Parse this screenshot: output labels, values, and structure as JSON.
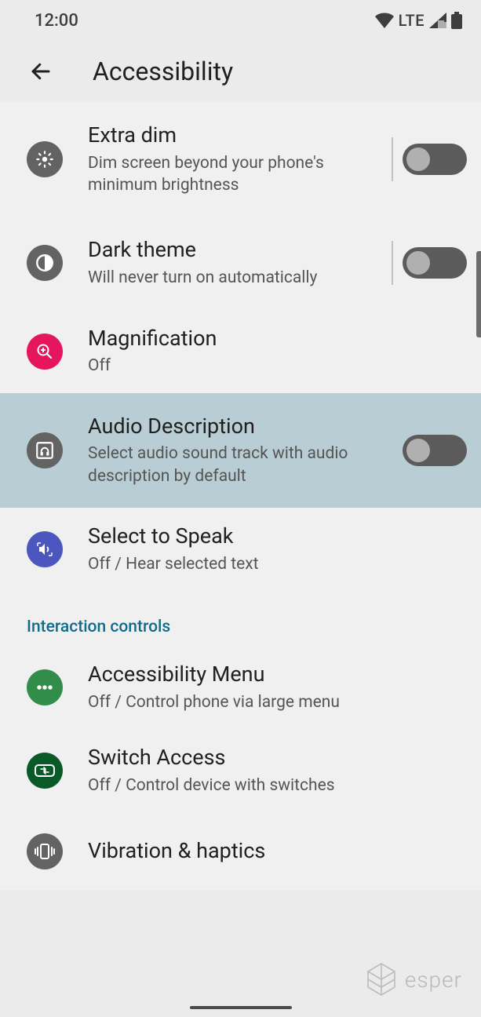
{
  "status": {
    "time": "12:00",
    "network": "LTE"
  },
  "appbar": {
    "title": "Accessibility"
  },
  "rows": {
    "extra_dim": {
      "title": "Extra dim",
      "sub": "Dim screen beyond your phone's minimum brightness"
    },
    "dark_theme": {
      "title": "Dark theme",
      "sub": "Will never turn on automatically"
    },
    "magnification": {
      "title": "Magnification",
      "sub": "Off"
    },
    "audio_desc": {
      "title": "Audio Description",
      "sub": "Select audio sound track with audio description by default"
    },
    "select_speak": {
      "title": "Select to Speak",
      "sub": "Off / Hear selected text"
    },
    "a11y_menu": {
      "title": "Accessibility Menu",
      "sub": "Off / Control phone via large menu"
    },
    "switch": {
      "title": "Switch Access",
      "sub": "Off / Control device with switches"
    },
    "vibration": {
      "title": "Vibration & haptics"
    }
  },
  "section": {
    "interaction": "Interaction controls"
  },
  "watermark": "esper"
}
